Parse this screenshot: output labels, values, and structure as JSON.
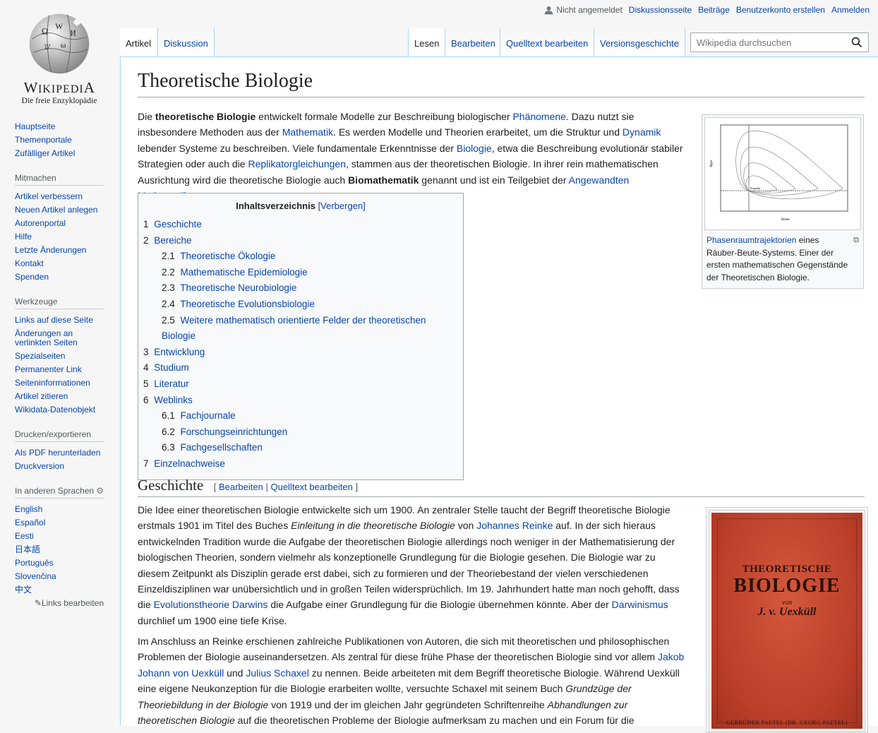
{
  "personal": {
    "not_logged_in": "Nicht angemeldet",
    "links": [
      "Diskussionsseite",
      "Beiträge",
      "Benutzerkonto erstellen",
      "Anmelden"
    ]
  },
  "logo": {
    "wordmark": "Wikipedia",
    "tagline": "Die freie Enzyklopädie"
  },
  "sidebar": {
    "main": [
      "Hauptseite",
      "Themenportale",
      "Zufälliger Artikel"
    ],
    "mitmachen": {
      "title": "Mitmachen",
      "items": [
        "Artikel verbessern",
        "Neuen Artikel anlegen",
        "Autorenportal",
        "Hilfe",
        "Letzte Änderungen",
        "Kontakt",
        "Spenden"
      ]
    },
    "werkzeuge": {
      "title": "Werkzeuge",
      "items": [
        "Links auf diese Seite",
        "Änderungen an verlinkten Seiten",
        "Spezialseiten",
        "Permanenter Link",
        "Seiteninformationen",
        "Artikel zitieren",
        "Wikidata-Datenobjekt"
      ]
    },
    "drucken": {
      "title": "Drucken/exportieren",
      "items": [
        "Als PDF herunterladen",
        "Druckversion"
      ]
    },
    "sprachen": {
      "title": "In anderen Sprachen",
      "items": [
        "English",
        "Español",
        "Eesti",
        "日本語",
        "Português",
        "Slovenčina",
        "中文"
      ],
      "edit_links": "Links bearbeiten"
    }
  },
  "tabs": {
    "left": [
      "Artikel",
      "Diskussion"
    ],
    "right": [
      "Lesen",
      "Bearbeiten",
      "Quelltext bearbeiten",
      "Versionsgeschichte"
    ]
  },
  "search": {
    "placeholder": "Wikipedia durchsuchen"
  },
  "article": {
    "title": "Theoretische Biologie",
    "intro": [
      {
        "t": "Die "
      },
      {
        "t": "theoretische Biologie",
        "b": true
      },
      {
        "t": " entwickelt formale Modelle zur Beschreibung biologischer "
      },
      {
        "t": "Phänomene",
        "l": true
      },
      {
        "t": ". Dazu nutzt sie insbesondere Methoden aus der "
      },
      {
        "t": "Mathematik",
        "l": true
      },
      {
        "t": ". Es werden Modelle und Theorien erarbeitet, um die Struktur und "
      },
      {
        "t": "Dynamik",
        "l": true
      },
      {
        "t": " lebender Systeme zu beschreiben. Viele fundamentale Erkenntnisse der "
      },
      {
        "t": "Biologie",
        "l": true
      },
      {
        "t": ", etwa die Beschreibung evolutionär stabiler Strategien oder auch die "
      },
      {
        "t": "Replikatorgleichungen",
        "l": true
      },
      {
        "t": ", stammen aus der theoretischen Biologie. In ihrer rein mathematischen Ausrichtung wird die theoretische Biologie auch "
      },
      {
        "t": "Biomathematik",
        "b": true
      },
      {
        "t": " genannt und ist ein Teilgebiet der "
      },
      {
        "t": "Angewandten Mathematik",
        "l": true
      },
      {
        "t": "."
      }
    ],
    "figure": {
      "caption_link": "Phasenraumtrajektorien",
      "caption_rest": " eines Räuber-Beute-Systems. Einer der ersten mathematischen Gegenstände der Theoretischen Biologie.",
      "ylabel": "Jäger",
      "xlabel": "Beute",
      "point_label": "Fixpunkt"
    },
    "toc": {
      "title": "Inhaltsverzeichnis",
      "toggle": "[Verbergen]",
      "entries": [
        {
          "n": "1",
          "t": "Geschichte",
          "lvl": 1
        },
        {
          "n": "2",
          "t": "Bereiche",
          "lvl": 1
        },
        {
          "n": "2.1",
          "t": "Theoretische Ökologie",
          "lvl": 2
        },
        {
          "n": "2.2",
          "t": "Mathematische Epidemiologie",
          "lvl": 2
        },
        {
          "n": "2.3",
          "t": "Theoretische Neurobiologie",
          "lvl": 2
        },
        {
          "n": "2.4",
          "t": "Theoretische Evolutionsbiologie",
          "lvl": 2
        },
        {
          "n": "2.5",
          "t": "Weitere mathematisch orientierte Felder der theoretischen Biologie",
          "lvl": 2
        },
        {
          "n": "3",
          "t": "Entwicklung",
          "lvl": 1
        },
        {
          "n": "4",
          "t": "Studium",
          "lvl": 1
        },
        {
          "n": "5",
          "t": "Literatur",
          "lvl": 1
        },
        {
          "n": "6",
          "t": "Weblinks",
          "lvl": 1
        },
        {
          "n": "6.1",
          "t": "Fachjournale",
          "lvl": 2
        },
        {
          "n": "6.2",
          "t": "Forschungseinrichtungen",
          "lvl": 2
        },
        {
          "n": "6.3",
          "t": "Fachgesellschaften",
          "lvl": 2
        },
        {
          "n": "7",
          "t": "Einzelnachweise",
          "lvl": 1
        }
      ]
    },
    "section1": {
      "title": "Geschichte",
      "edit": "Bearbeiten",
      "edit_source": "Quelltext bearbeiten",
      "para1": [
        {
          "t": "Die Idee einer theoretischen Biologie entwickelte sich um 1900. An zentraler Stelle taucht der Begriff theoretische Biologie erstmals 1901 im Titel des Buches "
        },
        {
          "t": "Einleitung in die theoretische Biologie",
          "i": true
        },
        {
          "t": " von "
        },
        {
          "t": "Johannes Reinke",
          "l": true
        },
        {
          "t": " auf. In der sich hieraus entwickelnden Tradition wurde die Aufgabe der theoretischen Biologie allerdings noch weniger in der Mathematisierung der biologischen Theorien, sondern vielmehr als konzeptionelle Grundlegung für die Biologie gesehen. Die Biologie war zu diesem Zeitpunkt als Disziplin gerade erst dabei, sich zu formieren und der Theoriebestand der vielen verschiedenen Einzeldisziplinen war unübersichtlich und in großen Teilen widersprüchlich. Im 19. Jahrhundert hatte man noch gehofft, dass die "
        },
        {
          "t": "Evolutionstheorie Darwins",
          "l": true
        },
        {
          "t": " die Aufgabe einer Grundlegung für die Biologie übernehmen könnte. Aber der "
        },
        {
          "t": "Darwinismus",
          "l": true
        },
        {
          "t": " durchlief um 1900 eine tiefe Krise."
        }
      ],
      "para2": [
        {
          "t": "Im Anschluss an Reinke erschienen zahlreiche Publikationen von Autoren, die sich mit theoretischen und philosophischen Problemen der Biologie auseinandersetzen. Als zentral für diese frühe Phase der theoretischen Biologie sind vor allem "
        },
        {
          "t": "Jakob Johann von Uexküll",
          "l": true
        },
        {
          "t": " und "
        },
        {
          "t": "Julius Schaxel",
          "l": true
        },
        {
          "t": " zu nennen. Beide arbeiteten mit dem Begriff theoretische Biologie. Während Uexküll eine eigene Neukonzeption für die Biologie erarbeiten wollte, versuchte Schaxel mit seinem Buch "
        },
        {
          "t": "Grundzüge der Theoriebildung in der Biologie",
          "i": true
        },
        {
          "t": " von 1919 und der im gleichen Jahr gegründeten Schriftenreihe "
        },
        {
          "t": "Abhandlungen zur theoretischen Biologie",
          "i": true
        },
        {
          "t": " auf die theoretischen Probleme der Biologie aufmerksam zu machen und ein Forum für die"
        }
      ],
      "book": {
        "line1": "THEORETISCHE",
        "line2": "BIOLOGIE",
        "line3": "von",
        "line4": "J. v. Uexküll",
        "publisher": "GEBRÜDER PAETEL (DR. GEORG PAETEL)"
      }
    }
  }
}
